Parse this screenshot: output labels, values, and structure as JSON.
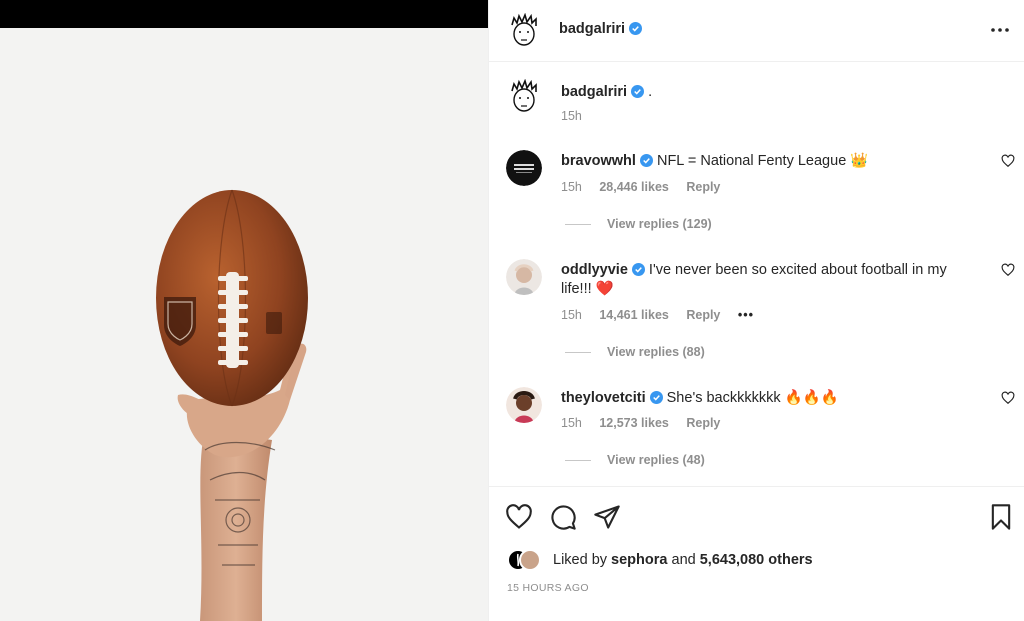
{
  "post": {
    "author": "badgalriri",
    "author_avatar": "sketch-face-avatar",
    "caption_text": ".",
    "caption_time": "15h",
    "more_icon": "ellipsis-icon"
  },
  "comments": [
    {
      "user": "bravowwhl",
      "text": "NFL = National Fenty League 👑",
      "time": "15h",
      "likes": "28,446 likes",
      "reply": "Reply",
      "more": "",
      "replies": "View replies (129)"
    },
    {
      "user": "oddlyyvie",
      "text": "I've never been so excited about football in my life!!! ❤️",
      "time": "15h",
      "likes": "14,461 likes",
      "reply": "Reply",
      "more": "•••",
      "replies": "View replies (88)"
    },
    {
      "user": "theylovetciti",
      "text": "She's backkkkkkk 🔥🔥🔥",
      "time": "15h",
      "likes": "12,573 likes",
      "reply": "Reply",
      "more": "",
      "replies": "View replies (48)"
    }
  ],
  "actions": {
    "icons": [
      "heart-icon",
      "comment-icon",
      "share-icon",
      "bookmark-icon"
    ]
  },
  "likes": {
    "prefix": "Liked by",
    "first_liker": "sephora",
    "conjunction": "and",
    "others": "5,643,080 others"
  },
  "timestamp": "15 HOURS AGO",
  "colors": {
    "verified": "#3897f0",
    "secondary_text": "#8e8e8e",
    "primary_text": "#262626",
    "ball": "#9a4a22"
  }
}
